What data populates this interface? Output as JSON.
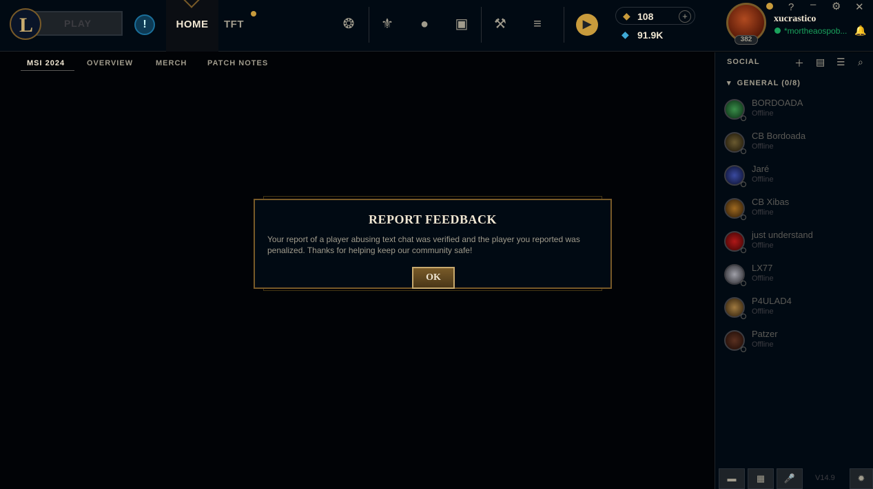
{
  "topbar": {
    "play_label": "PLAY",
    "nav_home": "HOME",
    "nav_tft": "TFT",
    "rp": "108",
    "be": "91.9K",
    "username": "xucrastico",
    "status_message": "*mortheaospob...",
    "level": "382",
    "logo_letter": "L",
    "window_controls": [
      "?",
      "–",
      "⚙",
      "✕"
    ]
  },
  "subnav": {
    "items": [
      "MSI 2024",
      "OVERVIEW",
      "MERCH",
      "PATCH NOTES"
    ]
  },
  "social": {
    "title": "SOCIAL",
    "group": "GENERAL (0/8)",
    "friends": [
      {
        "name": "BORDOADA",
        "status": "Offline"
      },
      {
        "name": "CB Bordoada",
        "status": "Offline"
      },
      {
        "name": "Jaré",
        "status": "Offline"
      },
      {
        "name": "CB Xibas",
        "status": "Offline"
      },
      {
        "name": "just understand",
        "status": "Offline"
      },
      {
        "name": "LX77",
        "status": "Offline"
      },
      {
        "name": "P4ULAD4",
        "status": "Offline"
      },
      {
        "name": "Patzer",
        "status": "Offline"
      }
    ],
    "version": "V14.9"
  },
  "modal": {
    "title": "REPORT FEEDBACK",
    "body": "Your report of a player abusing text chat was verified and the player you reported was penalized. Thanks for helping keep our community safe!",
    "ok_label": "OK"
  },
  "colors": {
    "gold": "#c89b3c",
    "gold_dark": "#785a28",
    "text_light": "#f0e6d2",
    "text_muted": "#a09b8c",
    "online_green": "#1aa25c",
    "background": "#010306"
  }
}
